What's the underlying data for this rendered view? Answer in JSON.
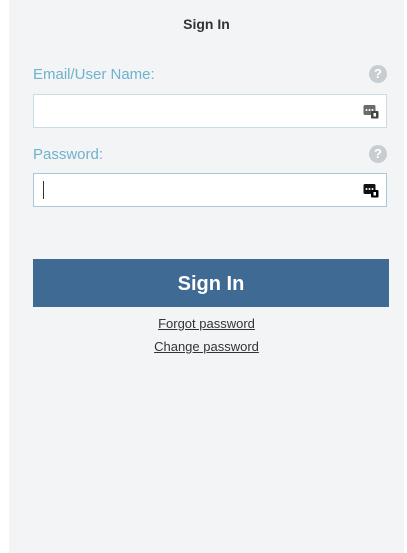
{
  "header": {
    "title": "Sign In"
  },
  "form": {
    "email": {
      "label": "Email/User Name:",
      "value": "",
      "help_icon": "?"
    },
    "password": {
      "label": "Password:",
      "value": "",
      "help_icon": "?"
    },
    "submit_label": "Sign In"
  },
  "links": {
    "forgot_password": "Forgot password",
    "change_password": "Change password"
  },
  "icons": {
    "help": "question-circle-icon",
    "password_manager": "password-manager-icon"
  },
  "colors": {
    "panel_bg": "#f2f4f6",
    "label": "#6fb2cc",
    "button_bg": "#3e6a94",
    "button_text": "#ffffff",
    "help_icon_bg": "#c8cdd2"
  }
}
